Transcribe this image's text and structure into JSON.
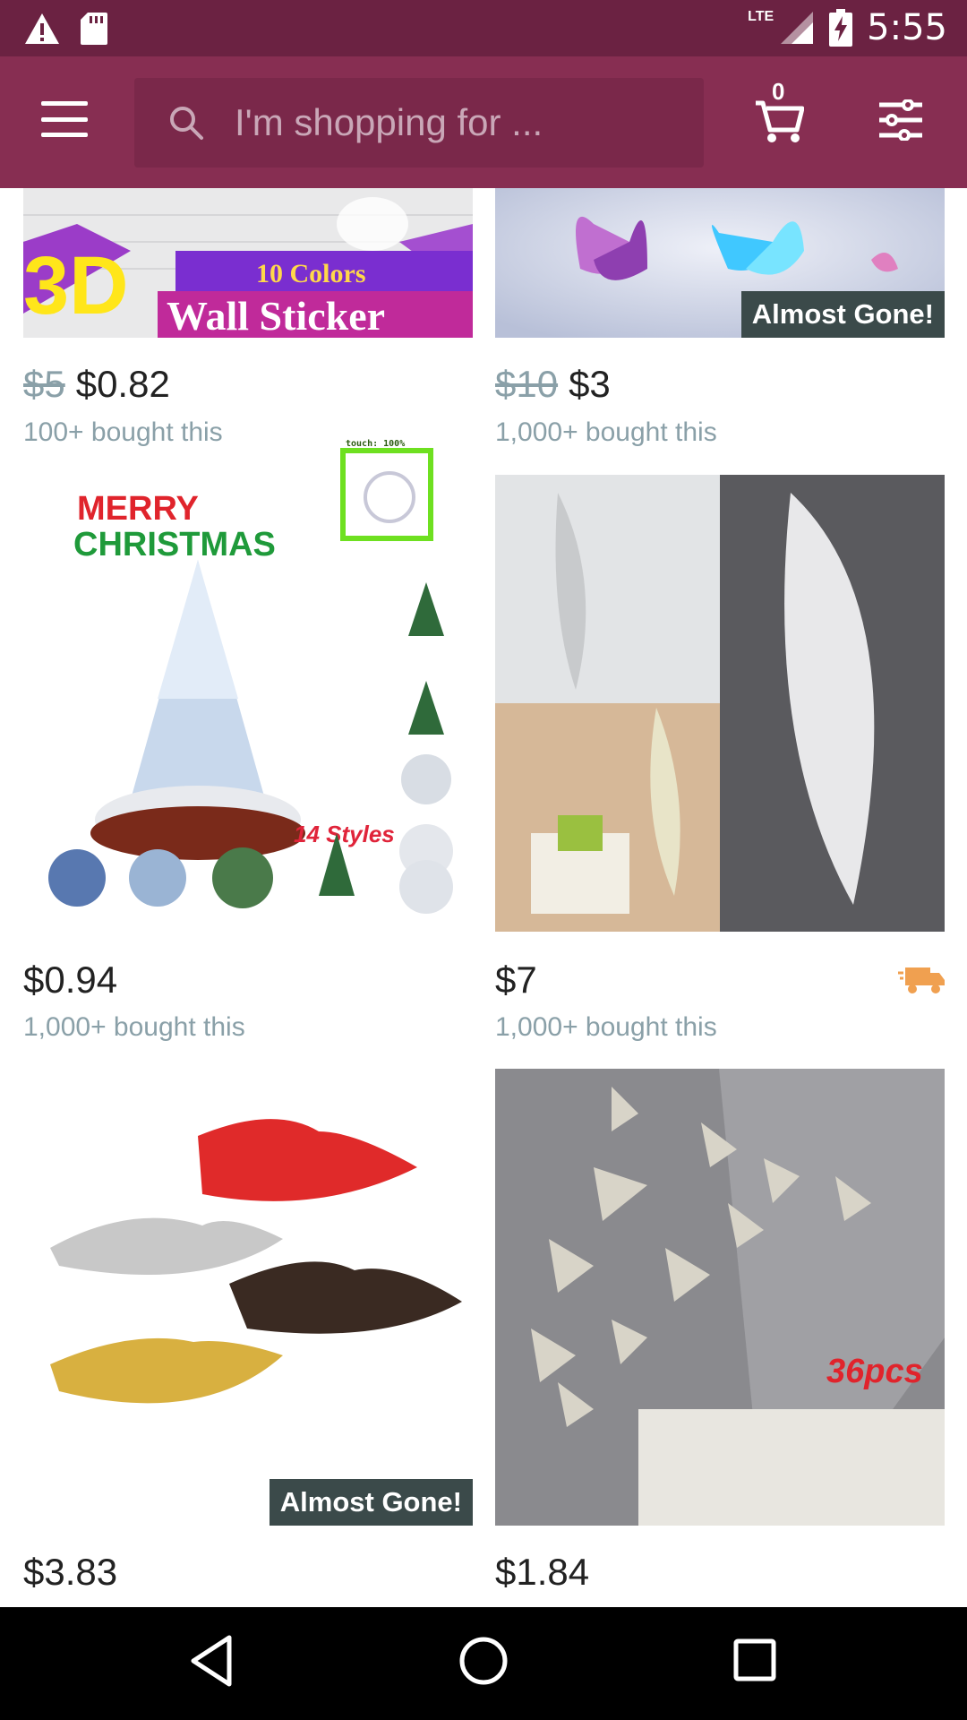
{
  "status_bar": {
    "time": "5:55",
    "network": "LTE",
    "icons": [
      "warning-icon",
      "sd-card-icon",
      "signal-icon",
      "battery-charging-icon"
    ]
  },
  "header": {
    "search_placeholder": "I'm shopping for ...",
    "cart_count": "0",
    "icons": [
      "menu-icon",
      "search-icon",
      "cart-icon",
      "filter-icon"
    ]
  },
  "products": [
    {
      "image_caption": "3D Wall Sticker",
      "image_text_top": "10 Colors",
      "image_text_main": "Wall Sticker",
      "image_text_big": "3D",
      "badge": "",
      "old_price": "$5",
      "price": "$0.82",
      "bought": "100+ bought this"
    },
    {
      "image_caption": "LED butterflies",
      "badge": "Almost Gone!",
      "old_price": "$10",
      "price": "$3",
      "bought": "1,000+ bought this"
    },
    {
      "image_caption": "Christmas tree ornaments",
      "image_text_1": "MERRY",
      "image_text_2": "CHRISTMAS",
      "image_text_3": "14 Styles",
      "badge": "",
      "old_price": "",
      "price": "$0.94",
      "bought": "1,000+ bought this"
    },
    {
      "image_caption": "Feather mirror stickers",
      "badge": "",
      "old_price": "",
      "price": "$7",
      "bought": "1,000+ bought this",
      "fast_shipping": true
    },
    {
      "image_caption": "Mirror lips stickers",
      "badge": "Almost Gone!",
      "old_price": "",
      "price": "$3.83",
      "bought": ""
    },
    {
      "image_caption": "Mirror butterfly stickers",
      "image_text": "36pcs",
      "badge": "",
      "old_price": "",
      "price": "$1.84",
      "bought": ""
    }
  ],
  "touch_indicator": {
    "label": "touch: 100%"
  },
  "colors": {
    "status_bar": "#6b2242",
    "header": "#872e52",
    "search_bg": "#7a284a",
    "badge": "#3b4a4a",
    "muted_text": "#8aa0a8",
    "shipping_orange": "#f0a050"
  },
  "nav_bar": {
    "icons": [
      "back-icon",
      "home-icon",
      "recents-icon"
    ]
  }
}
